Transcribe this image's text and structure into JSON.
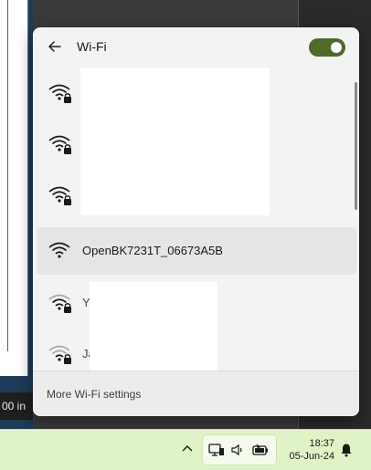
{
  "background": {
    "status_text": "00 in"
  },
  "flyout": {
    "back_icon": "back-arrow-icon",
    "title": "Wi-Fi",
    "toggle_state": "on",
    "accent_color": "#4e6b2d",
    "networks": [
      {
        "name": "",
        "secured": true
      },
      {
        "name": "",
        "secured": true
      },
      {
        "name": "",
        "secured": true
      },
      {
        "name": "OpenBK7231T_06673A5B",
        "secured": false,
        "active": true
      },
      {
        "name": "Yo",
        "secured": true
      },
      {
        "name": "Ja",
        "secured": true
      }
    ],
    "footer_link": "More Wi-Fi settings"
  },
  "taskbar": {
    "chevron_icon": "chevron-up-icon",
    "tray_icons": [
      "network-icon",
      "speaker-icon",
      "battery-icon"
    ],
    "time": "18:37",
    "date": "05-Jun-24",
    "bell_icon": "notification-bell-icon"
  }
}
